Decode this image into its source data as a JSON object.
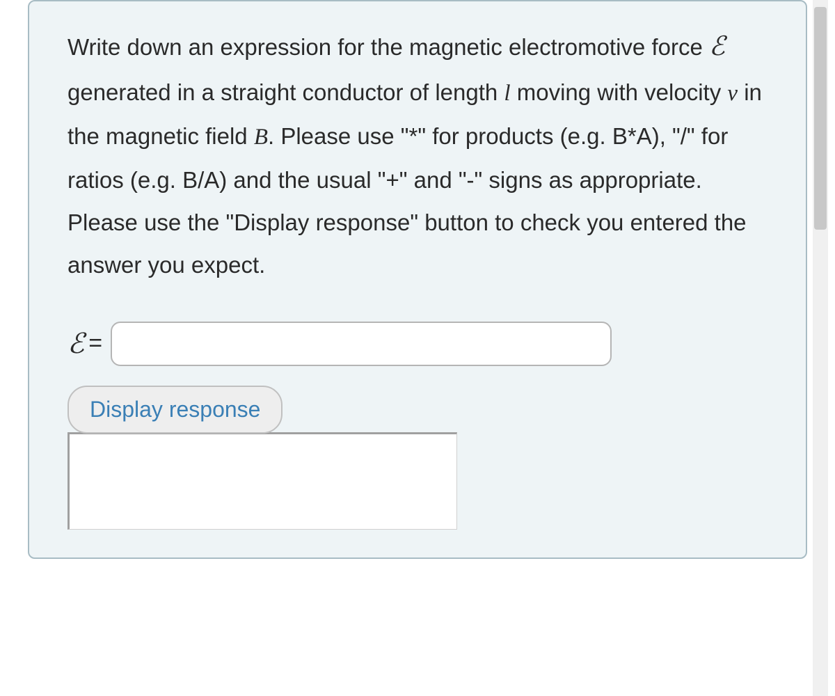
{
  "question": {
    "part1": "Write down an expression for the magnetic electromotive force ",
    "emf_symbol": "ℰ",
    "part2": " generated in a straight conductor  of length ",
    "length_symbol": "l",
    "part3": " moving with velocity ",
    "velocity_symbol": "v",
    "part4": " in the magnetic field ",
    "field_symbol": "B",
    "part5": ". Please use \"*\" for products (e.g. B*A), \"/\" for ratios (e.g. B/A) and the usual \"+\" and \"-\" signs as appropriate. Please use the \"Display response\" button to check you entered the answer you expect."
  },
  "answer": {
    "label_symbol": "ℰ",
    "equals": "=",
    "value": ""
  },
  "buttons": {
    "display_response": "Display response"
  }
}
